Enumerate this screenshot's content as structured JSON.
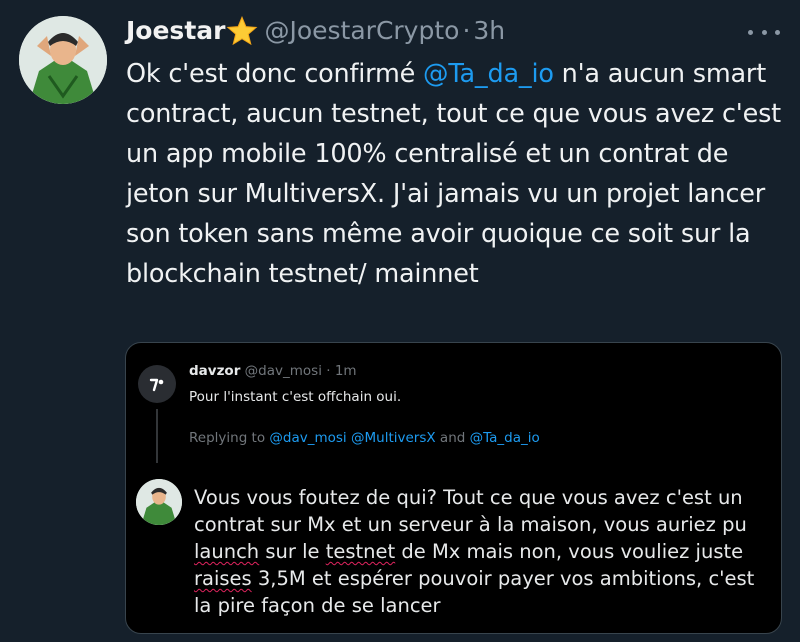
{
  "tweet": {
    "author_name": "Joestar",
    "author_handle": "@JoestarCrypto",
    "separator": "·",
    "time": "3h",
    "text_part1": "Ok c'est donc confirmé ",
    "mention": "@Ta_da_io",
    "text_part2": " n'a aucun smart contract, aucun testnet, tout ce que vous avez c'est un app mobile 100% centralisé et un contrat de jeton sur MultiversX. J'ai jamais vu un projet lancer son token sans même avoir quoique ce soit sur la blockchain testnet/ mainnet"
  },
  "quoted": {
    "name": "davzor",
    "handle": "@dav_mosi",
    "separator": "·",
    "time": "1m",
    "text": "Pour l'instant c'est offchain oui.",
    "replying_prefix": "Replying to ",
    "replying_m1": "@dav_mosi",
    "replying_m2": "@MultiversX",
    "replying_and": " and ",
    "replying_m3": "@Ta_da_io"
  },
  "draft": {
    "p1": "Vous vous foutez de qui? Tout ce que vous avez c'est un contrat sur Mx et un serveur à la maison, vous auriez pu ",
    "w1": "launch",
    "p2": " sur le ",
    "w2": "testnet",
    "p3": " de Mx mais non, vous vouliez juste ",
    "w3": "raises",
    "p4": " 3,5M et espérer pouvoir payer vos ambitions, c'est la pire façon de se lancer"
  },
  "icons": {
    "verified": "star-emoji-icon",
    "more": "more-options-icon",
    "quoted_avatar": "logo-icon"
  },
  "colors": {
    "background": "#15202b",
    "link": "#1d9bf0",
    "muted": "#8b98a5"
  }
}
